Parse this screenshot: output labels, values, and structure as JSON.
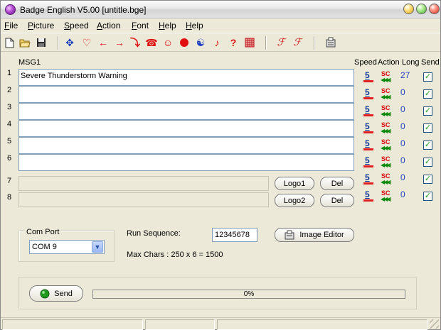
{
  "window": {
    "title": "Badge English V5.00 [untitle.bge]"
  },
  "menu": [
    {
      "pre": "",
      "u": "F",
      "post": "ile"
    },
    {
      "pre": "",
      "u": "P",
      "post": "icture"
    },
    {
      "pre": "",
      "u": "S",
      "post": "peed"
    },
    {
      "pre": "",
      "u": "A",
      "post": "ction"
    },
    {
      "pre": "",
      "u": "F",
      "post": "ont"
    },
    {
      "pre": "",
      "u": "H",
      "post": "elp"
    },
    {
      "pre": "",
      "u": "H",
      "post": "elp"
    }
  ],
  "toolbar": {
    "icons": [
      "new-file-icon",
      "open-folder-icon",
      "save-disk-icon",
      "move-cross-icon",
      "heart-icon",
      "arrow-left-icon",
      "arrow-right-icon",
      "step-arrow-icon",
      "telephone-icon",
      "smiley-icon",
      "red-circle-icon",
      "yin-yang-icon",
      "music-note-icon",
      "question-mark-icon",
      "grid-pattern-icon",
      "font-f-icon",
      "font-f-italic-icon",
      "settings-tool-icon"
    ]
  },
  "headers": {
    "msg": "MSG1",
    "speed": "Speed",
    "action": "Action",
    "long": "Long",
    "send": "Send"
  },
  "rows": [
    {
      "num": "1",
      "text": "Severe Thunderstorm Warning",
      "speed": "5",
      "action": "SC",
      "long": "27",
      "send": true
    },
    {
      "num": "2",
      "text": "",
      "speed": "5",
      "action": "SC",
      "long": "0",
      "send": true
    },
    {
      "num": "3",
      "text": "",
      "speed": "5",
      "action": "SC",
      "long": "0",
      "send": true
    },
    {
      "num": "4",
      "text": "",
      "speed": "5",
      "action": "SC",
      "long": "0",
      "send": true
    },
    {
      "num": "5",
      "text": "",
      "speed": "5",
      "action": "SC",
      "long": "0",
      "send": true
    },
    {
      "num": "6",
      "text": "",
      "speed": "5",
      "action": "SC",
      "long": "0",
      "send": true
    },
    {
      "num": "7",
      "text": "",
      "speed": "5",
      "action": "SC",
      "long": "0",
      "send": true
    },
    {
      "num": "8",
      "text": "",
      "speed": "5",
      "action": "SC",
      "long": "0",
      "send": true
    }
  ],
  "logo_rows": [
    {
      "logo": "Logo1",
      "del": "Del"
    },
    {
      "logo": "Logo2",
      "del": "Del"
    }
  ],
  "com": {
    "title": "Com Port",
    "value": "COM 9"
  },
  "run": {
    "label": "Run Sequence:",
    "value": "12345678",
    "maxchars": "Max Chars : 250 x 6 = 1500"
  },
  "image_editor": "Image Editor",
  "send_button": "Send",
  "progress": {
    "text": "0%",
    "value": 0
  },
  "colors": {
    "accent": "#12389c",
    "check": "#21a121",
    "action": "#d40000",
    "window_bg": "#ece9d8"
  }
}
